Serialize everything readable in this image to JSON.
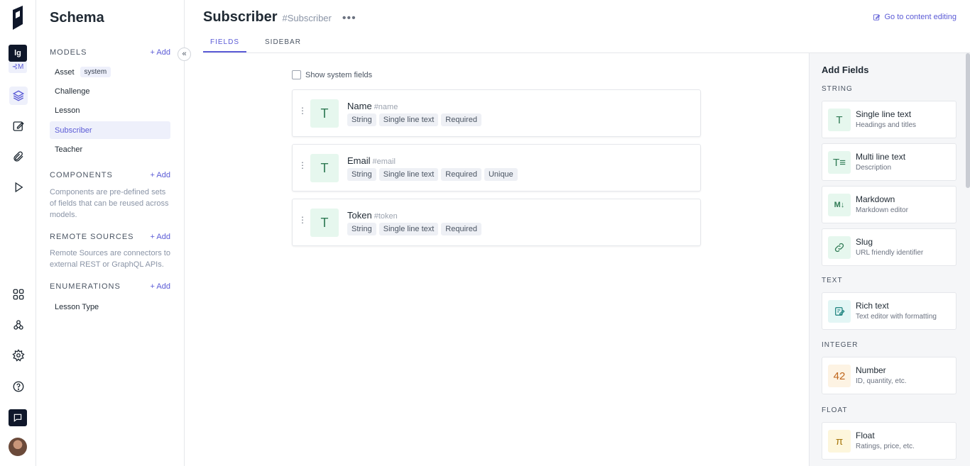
{
  "rail": {
    "project_initials": "lg",
    "env_label": "⊰M",
    "icons": [
      "layers-icon",
      "edit-icon",
      "paperclip-icon",
      "play-icon",
      "apps-icon",
      "webhooks-icon",
      "settings-icon",
      "help-icon",
      "chat-icon"
    ]
  },
  "sidebar": {
    "title": "Schema",
    "collapse_glyph": "«",
    "models": {
      "label": "MODELS",
      "add": "+ Add",
      "items": [
        {
          "label": "Asset",
          "badge": "system"
        },
        {
          "label": "Challenge"
        },
        {
          "label": "Lesson"
        },
        {
          "label": "Subscriber"
        },
        {
          "label": "Teacher"
        }
      ]
    },
    "components": {
      "label": "COMPONENTS",
      "add": "+ Add",
      "description": "Components are pre-defined sets of fields that can be reused across models."
    },
    "remote_sources": {
      "label": "REMOTE SOURCES",
      "add": "+ Add",
      "description": "Remote Sources are connectors to external REST or GraphQL APIs."
    },
    "enumerations": {
      "label": "ENUMERATIONS",
      "add": "+ Add",
      "items": [
        {
          "label": "Lesson Type"
        }
      ]
    }
  },
  "main": {
    "title": "Subscriber",
    "api_id": "#Subscriber",
    "more": "•••",
    "goto_content": "Go to content editing",
    "tabs": [
      {
        "label": "FIELDS"
      },
      {
        "label": "SIDEBAR"
      }
    ],
    "show_system_fields": "Show system fields",
    "fields": [
      {
        "name": "Name",
        "key": "#name",
        "icon": "T",
        "tags": [
          "String",
          "Single line text",
          "Required"
        ]
      },
      {
        "name": "Email",
        "key": "#email",
        "icon": "T",
        "tags": [
          "String",
          "Single line text",
          "Required",
          "Unique"
        ]
      },
      {
        "name": "Token",
        "key": "#token",
        "icon": "T",
        "tags": [
          "String",
          "Single line text",
          "Required"
        ]
      }
    ]
  },
  "add_fields": {
    "title": "Add Fields",
    "groups": {
      "string": "STRING",
      "text": "TEXT",
      "integer": "INTEGER",
      "float": "FLOAT"
    },
    "types": [
      {
        "name": "Single line text",
        "desc": "Headings and titles",
        "glyph": "T",
        "bg": "#e6f7ee",
        "fg": "#2f7a54"
      },
      {
        "name": "Multi line text",
        "desc": "Description",
        "glyph": "T≡",
        "bg": "#e6f7ee",
        "fg": "#2f7a54"
      },
      {
        "name": "Markdown",
        "desc": "Markdown editor",
        "glyph": "M↓",
        "bg": "#e6f7ee",
        "fg": "#2f7a54"
      },
      {
        "name": "Slug",
        "desc": "URL friendly identifier",
        "glyph": "⛓",
        "bg": "#e6f7ee",
        "fg": "#2f7a54"
      },
      {
        "name": "Rich text",
        "desc": "Text editor with formatting",
        "glyph": "✎",
        "bg": "#e3f6f5",
        "fg": "#2a8a86"
      },
      {
        "name": "Number",
        "desc": "ID, quantity, etc.",
        "glyph": "42",
        "bg": "#fdf3e3",
        "fg": "#c0661c"
      },
      {
        "name": "Float",
        "desc": "Ratings, price, etc.",
        "glyph": "π",
        "bg": "#fdf6dc",
        "fg": "#a8780f"
      }
    ]
  }
}
